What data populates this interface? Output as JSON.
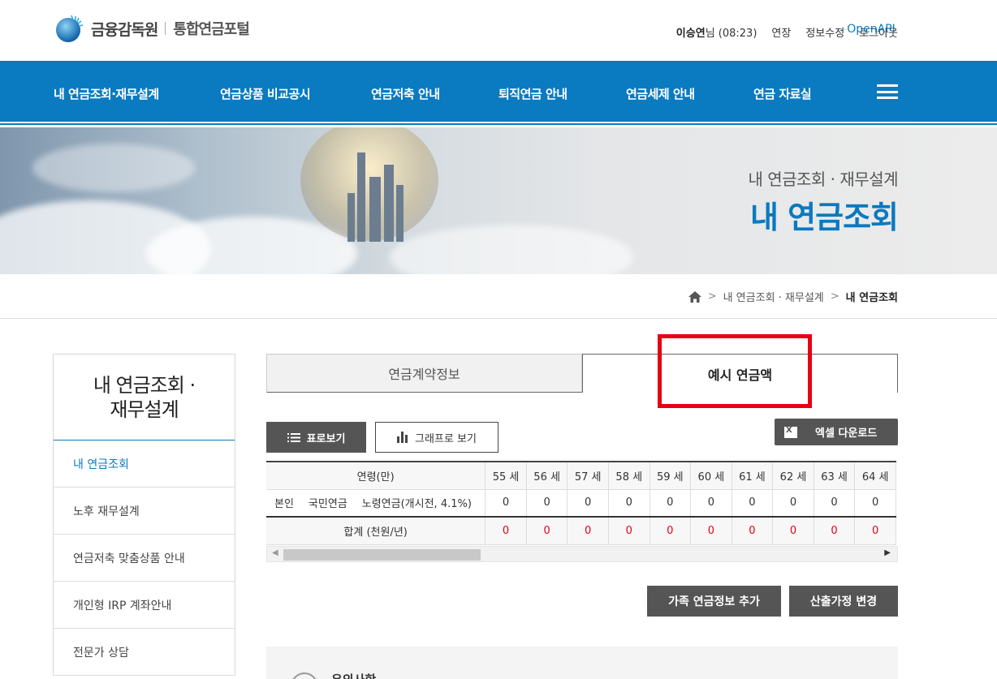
{
  "header": {
    "org_name": "금융감독원",
    "portal_name": "통합연금포털",
    "user_name": "이승연",
    "user_suffix": "님 (08:23)",
    "extend_label": "연장",
    "edit_info_label": "정보수정",
    "logout_label": "로그아웃",
    "openapi_label": "OpenAPI"
  },
  "nav": {
    "items": [
      "내 연금조회·재무설계",
      "연금상품 비교공시",
      "연금저축 안내",
      "퇴직연금 안내",
      "연금세제 안내",
      "연금 자료실"
    ]
  },
  "banner": {
    "subtitle": "내 연금조회 · 재무설계",
    "title": "내 연금조회"
  },
  "breadcrumb": {
    "parent": "내 연금조회 · 재무설계",
    "current": "내 연금조회"
  },
  "sidebar": {
    "title_line1": "내 연금조회 ·",
    "title_line2": "재무설계",
    "items": [
      "내 연금조회",
      "노후 재무설계",
      "연금저축 맞춤상품 안내",
      "개인형 IRP 계좌안내",
      "전문가 상담"
    ],
    "active_index": 0
  },
  "tabs": {
    "contract_info": "연금계약정보",
    "expected_amount": "예시 연금액",
    "active": "expected_amount"
  },
  "toolbar": {
    "table_view": "표로보기",
    "graph_view": "그래프로 보기",
    "excel_download": "엑셀 다운로드"
  },
  "table": {
    "header_label": "연령(만)",
    "ages": [
      "55 세",
      "56 세",
      "57 세",
      "58 세",
      "59 세",
      "60 세",
      "61 세",
      "62 세",
      "63 세",
      "64 세"
    ],
    "rows": [
      {
        "who": "본인",
        "type": "국민연금",
        "product": "노령연금(개시전, 4.1%)",
        "values": [
          "0",
          "0",
          "0",
          "0",
          "0",
          "0",
          "0",
          "0",
          "0",
          "0"
        ]
      }
    ],
    "total_label": "합계 (천원/년)",
    "totals": [
      "0",
      "0",
      "0",
      "0",
      "0",
      "0",
      "0",
      "0",
      "0",
      "0"
    ]
  },
  "actions": {
    "add_family": "가족 연금정보 추가",
    "change_assumption": "산출가정 변경"
  },
  "notice": {
    "title": "유의사항"
  },
  "colors": {
    "brand_blue": "#0a7ac1",
    "highlight_red": "#e60012",
    "button_dark": "#555555"
  }
}
